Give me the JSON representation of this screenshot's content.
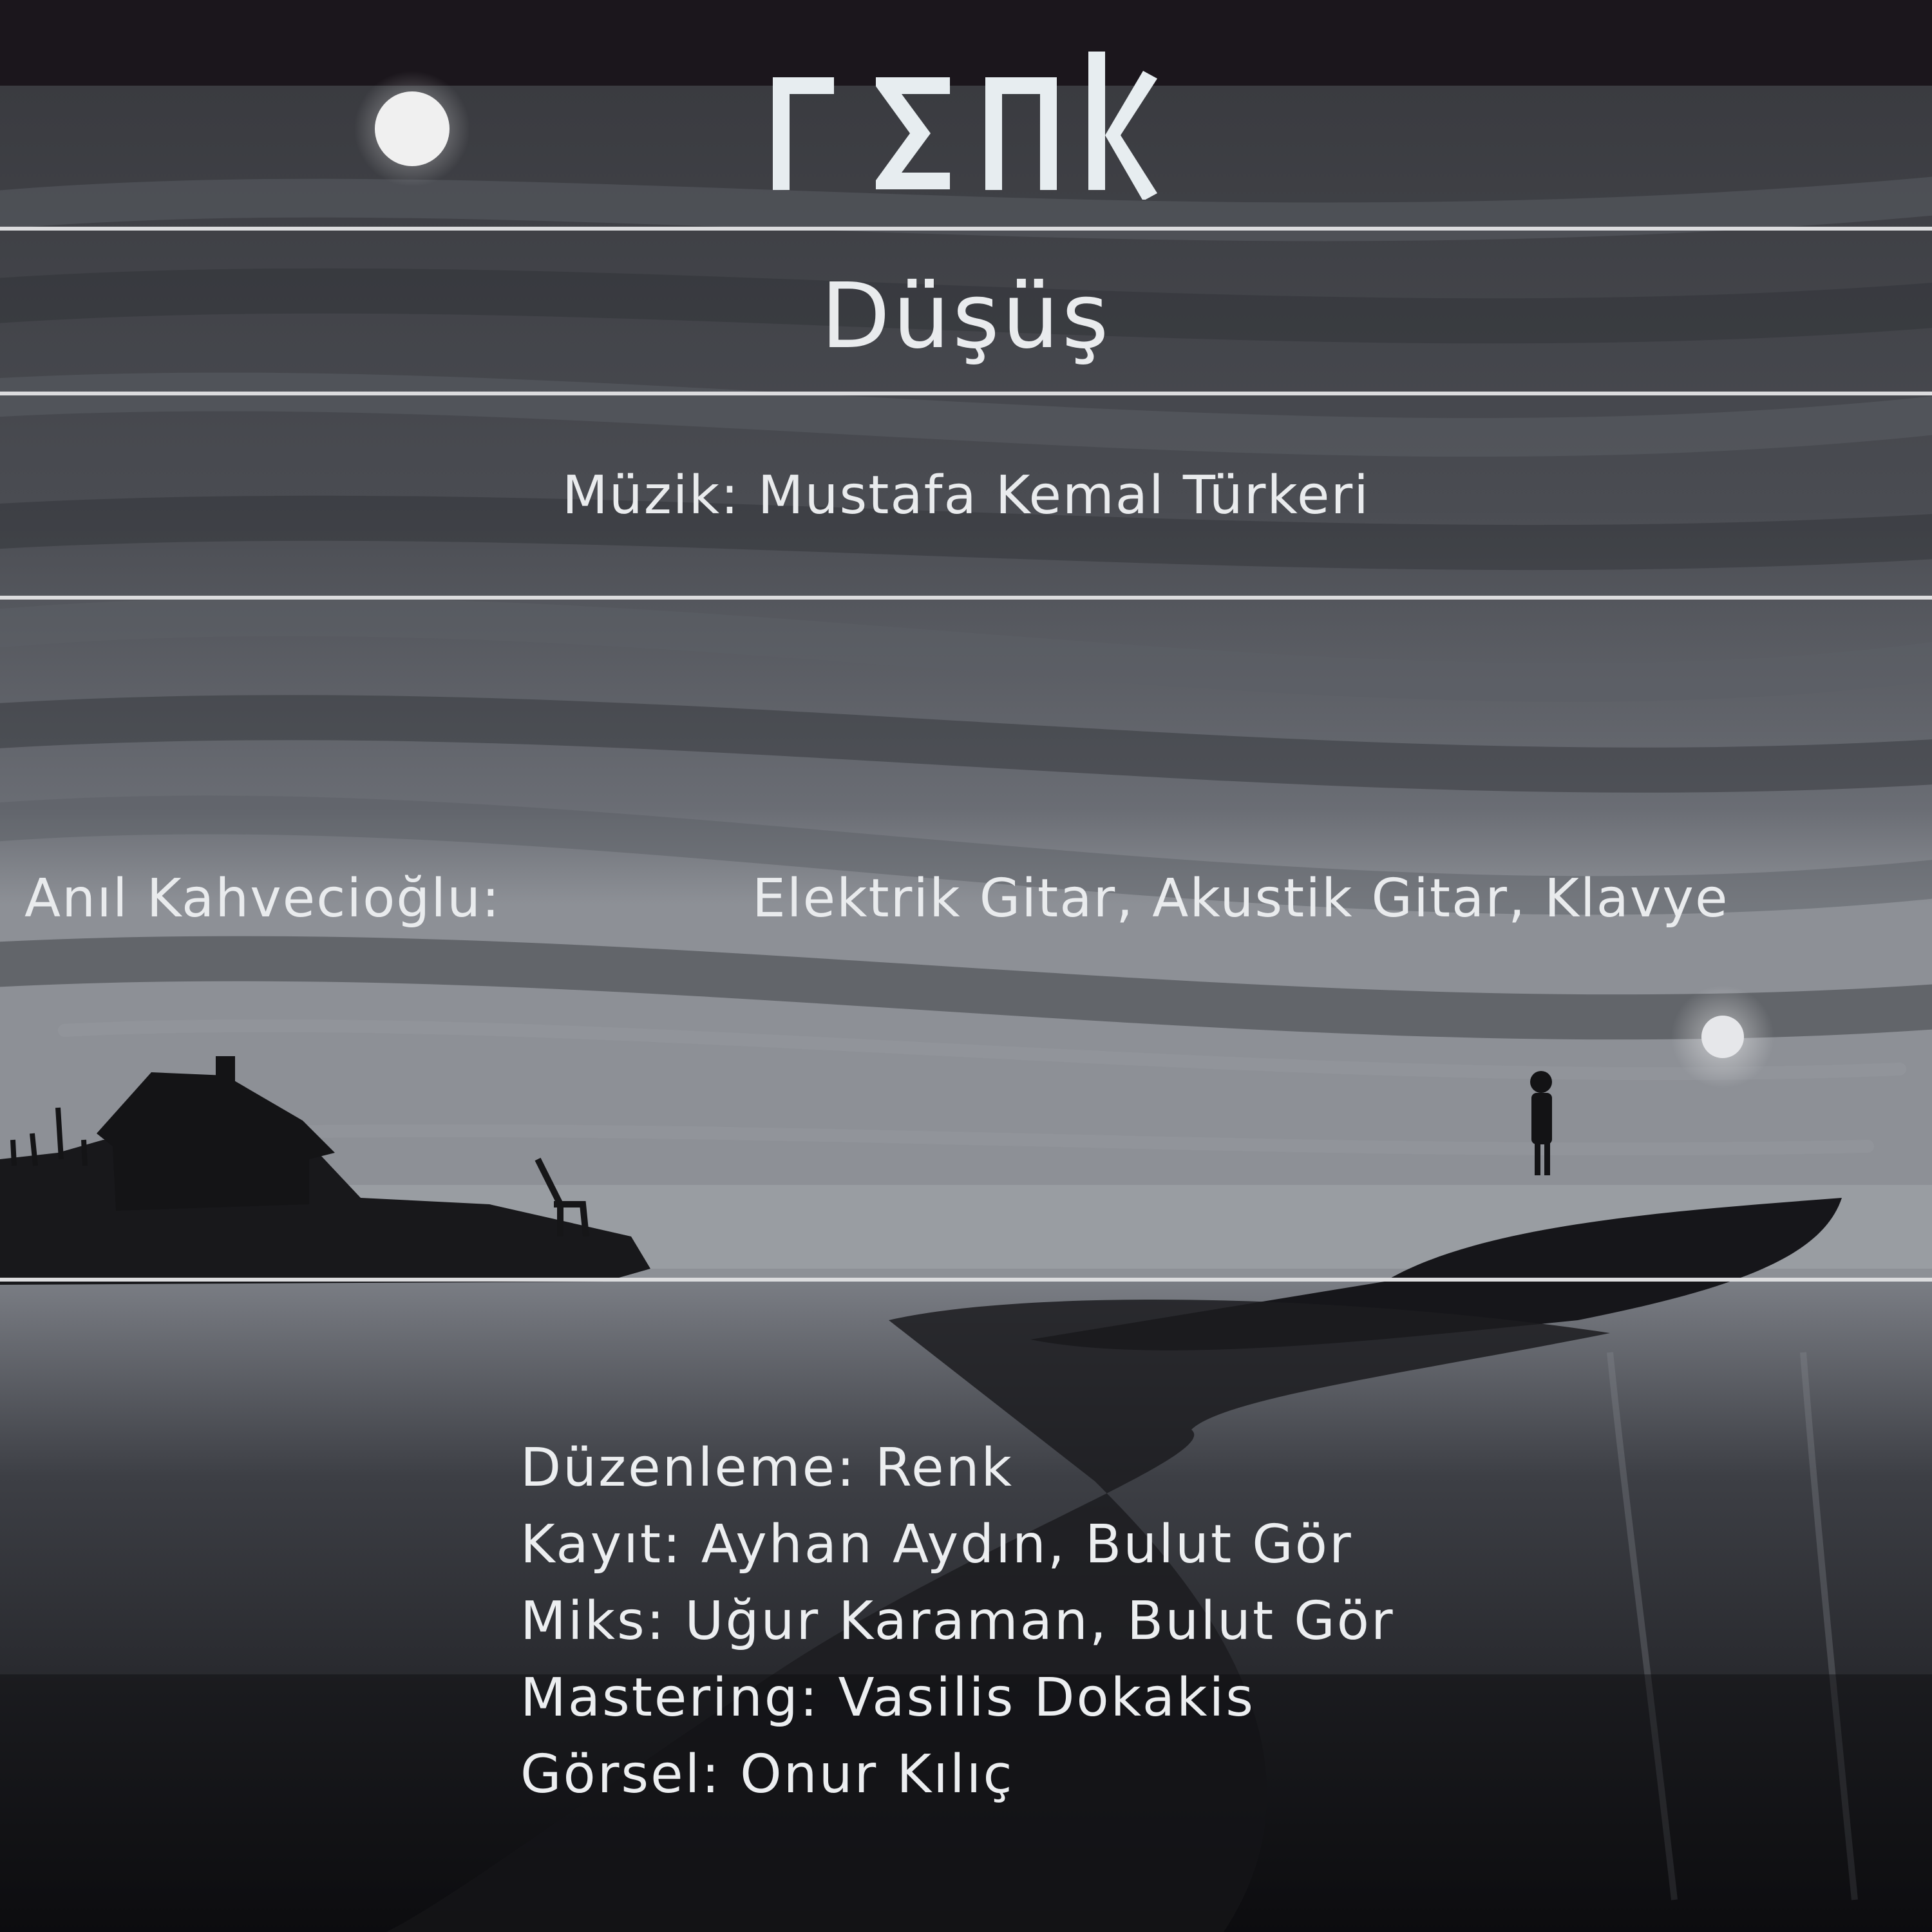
{
  "logo": {
    "text": "renk",
    "color": "#e7edf0"
  },
  "title": "Düşüş",
  "music_credit": "Müzik: Mustafa Kemal Türkeri",
  "musician": {
    "name": "Anıl Kahvecioğlu:",
    "instruments": "Elektrik Gitar, Akustik Gitar, Klavye"
  },
  "credits": [
    "Düzenleme: Renk",
    "Kayıt: Ayhan Aydın, Bulut Gör",
    "Miks: Uğur Karaman, Bulut Gör",
    "Mastering: Vasilis Dokakis",
    "Görsel: Onur Kılıç"
  ],
  "colors": {
    "top_band": "#1b161c",
    "rules": "#dcdcde",
    "text": "#e9ebed"
  }
}
